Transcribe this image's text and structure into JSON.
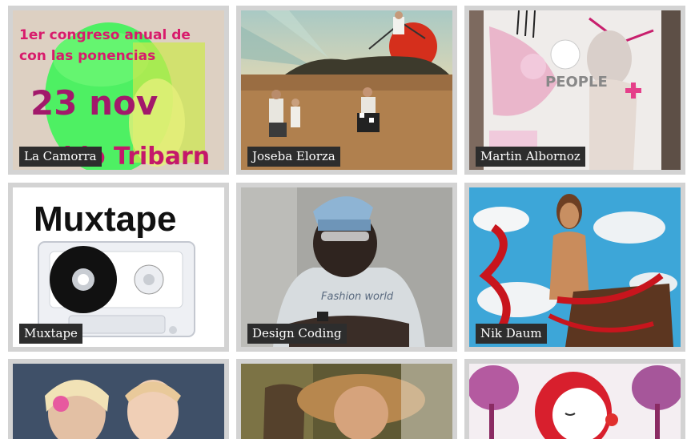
{
  "gallery": {
    "items": [
      {
        "label": "La Camorra"
      },
      {
        "label": "Joseba Elorza"
      },
      {
        "label": "Martin Albornoz"
      },
      {
        "label": "Muxtape"
      },
      {
        "label": "Design Coding"
      },
      {
        "label": "Nik Daum"
      },
      {
        "label": ""
      },
      {
        "label": ""
      },
      {
        "label": ""
      }
    ]
  },
  "thumbnails": {
    "camorra_poster": {
      "line1": "1er congreso anual de",
      "line2": "con las ponencias",
      "date": "23 nov",
      "bottom": "Aldo Tribarn"
    },
    "albornoz_art": {
      "word": "PEOPLE"
    },
    "muxtape_logo": {
      "title": "Muxtape"
    },
    "coding_shirt": {
      "text": "Fashion world"
    }
  },
  "colors": {
    "tile_border": "#d3d3d3",
    "label_bg": "#2d2d2d",
    "label_text": "#ffffff"
  }
}
